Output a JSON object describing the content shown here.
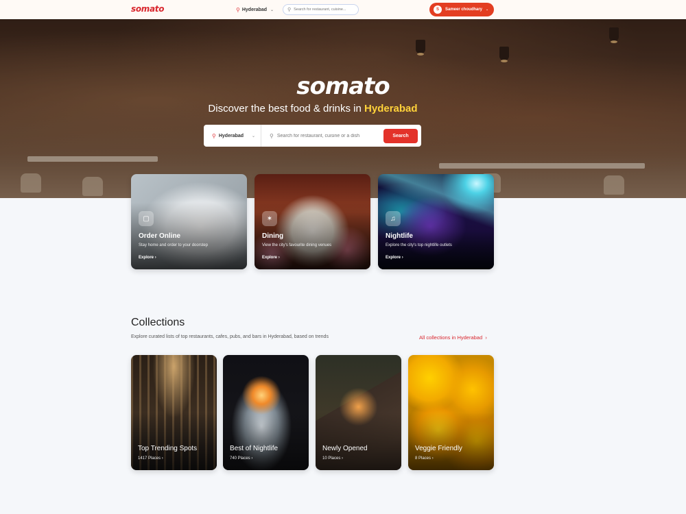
{
  "brand": {
    "logo_text": "somato"
  },
  "nav": {
    "location": "Hyderabad",
    "search_placeholder": "Search for restaurant, cuisine...",
    "user_initial": "S",
    "user_name": "Sameer choudhary"
  },
  "hero": {
    "title": "somato",
    "tagline_prefix": "Discover the best food & drinks in ",
    "tagline_city": "Hyderabad",
    "search": {
      "location": "Hyderabad",
      "placeholder": "Search for restaurant, cuisine or a dish",
      "button": "Search"
    }
  },
  "features": [
    {
      "title": "Order Online",
      "description": "Stay home and order to your doorstep",
      "cta": "Explore",
      "icon": "bag-icon"
    },
    {
      "title": "Dining",
      "description": "View the city's favourite dining venues",
      "cta": "Explore",
      "icon": "fork-knife-icon"
    },
    {
      "title": "Nightlife",
      "description": "Explore the city's top nightlife outlets",
      "cta": "Explore",
      "icon": "music-note-icon"
    }
  ],
  "collections": {
    "title": "Collections",
    "subtitle": "Explore curated lists of top restaurants, cafes, pubs, and bars in Hyderabad, based on trends",
    "all_link": "All collections in Hyderabad",
    "items": [
      {
        "title": "Top Trending Spots",
        "places": "1417 Places"
      },
      {
        "title": "Best of Nightlife",
        "places": "740 Places"
      },
      {
        "title": "Newly Opened",
        "places": "10 Places"
      },
      {
        "title": "Veggie Friendly",
        "places": "8 Places"
      }
    ]
  },
  "colors": {
    "brand_red": "#d9272e",
    "accent_orange": "#e33e22",
    "city_yellow": "#ffd23a"
  }
}
